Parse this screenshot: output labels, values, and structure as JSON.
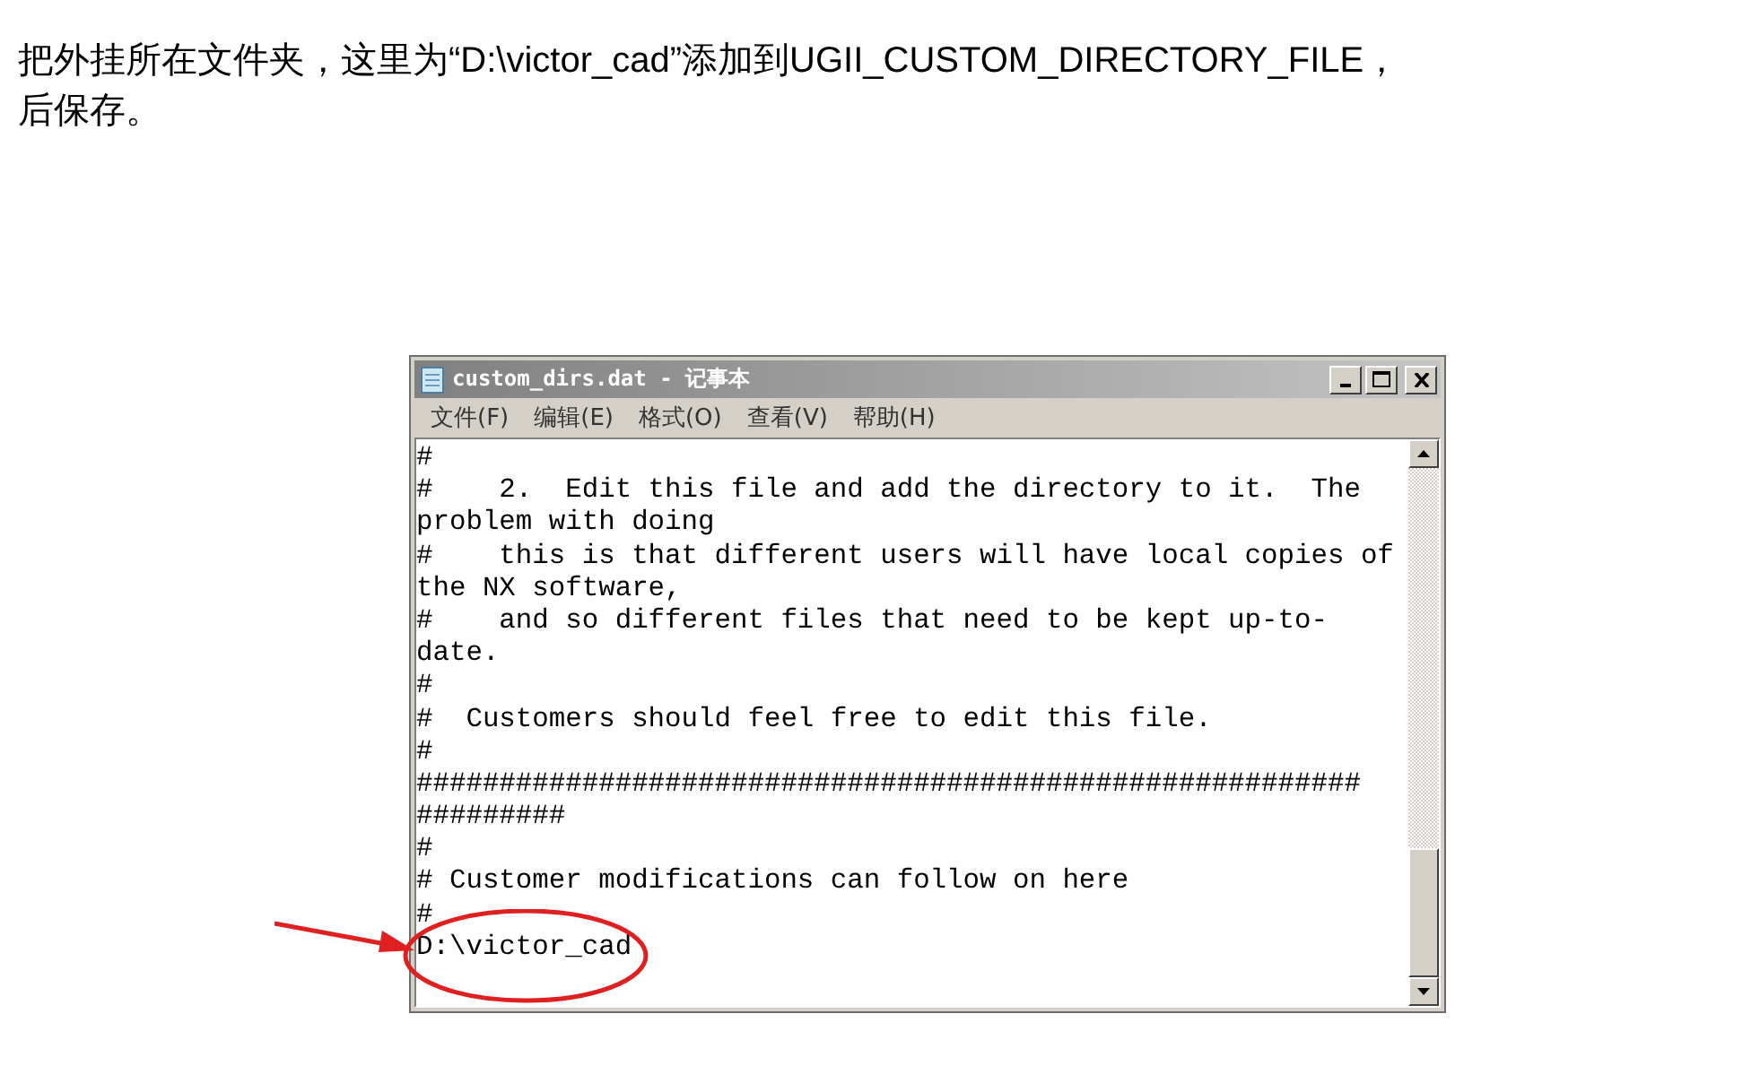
{
  "paragraph_lines": [
    "把外挂所在文件夹，这里为“D:\\victor_cad”添加到UGII_CUSTOM_DIRECTORY_FILE，",
    "后保存。"
  ],
  "window": {
    "title": "custom_dirs.dat - 记事本",
    "menu": [
      "文件(F)",
      "编辑(E)",
      "格式(O)",
      "查看(V)",
      "帮助(H)"
    ],
    "lines": [
      "#",
      "#    2.  Edit this file and add the directory to it.  The",
      "problem with doing",
      "#    this is that different users will have local copies of",
      "the NX software,",
      "#    and so different files that need to be kept up-to-",
      "date.",
      "#",
      "#  Customers should feel free to edit this file.",
      "#",
      "#########################################################",
      "#########",
      "#",
      "# Customer modifications can follow on here",
      "#",
      "D:\\victor_cad"
    ]
  }
}
